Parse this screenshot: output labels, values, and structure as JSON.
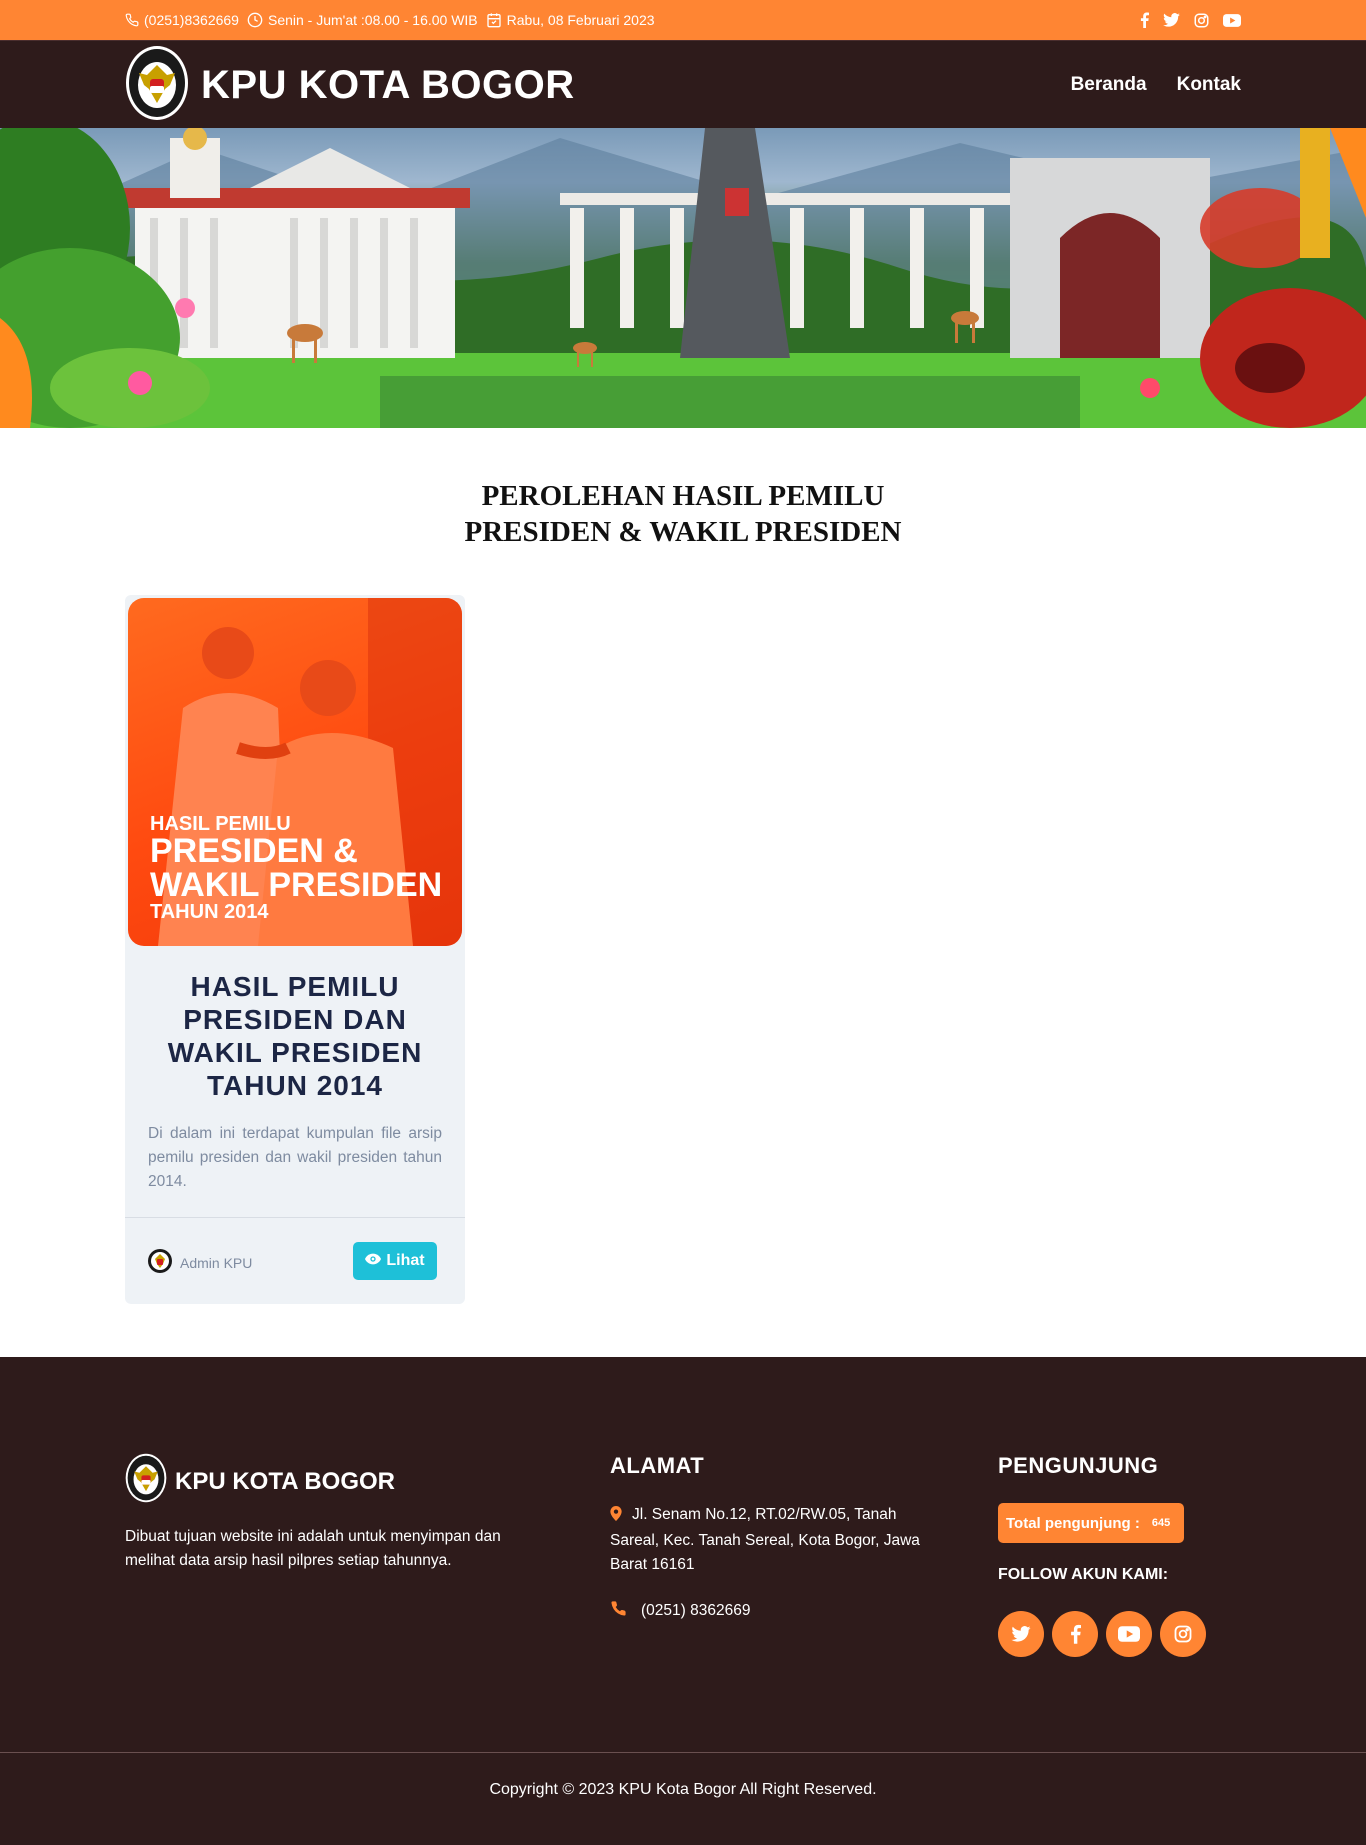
{
  "topbar": {
    "phone": "(0251)8362669",
    "hours": "Senin - Jum'at :08.00 - 16.00 WIB",
    "date": "Rabu, 08 Februari 2023",
    "social_icons": [
      "facebook-icon",
      "twitter-icon",
      "instagram-icon",
      "youtube-icon"
    ]
  },
  "header": {
    "logo_text_top": "KOMISI",
    "logo_text_bottom": "PEMILIHAN UMUM",
    "title": "KPU KOTA BOGOR",
    "nav": [
      "Beranda",
      "Kontak"
    ]
  },
  "main": {
    "title_line1": "PEROLEHAN HASIL PEMILU",
    "title_line2": "PRESIDEN & WAKIL PRESIDEN",
    "card": {
      "image_line1": "HASIL PEMILU",
      "image_line2": "PRESIDEN &",
      "image_line3": "WAKIL PRESIDEN",
      "image_line4": "TAHUN 2014",
      "title": "HASIL PEMILU PRESIDEN DAN WAKIL PRESIDEN TAHUN 2014",
      "description": "Di dalam ini terdapat kumpulan file arsip pemilu presiden dan wakil presiden tahun 2014.",
      "author": "Admin KPU",
      "button_label": "Lihat"
    }
  },
  "footer": {
    "brand": "KPU KOTA BOGOR",
    "about": "Dibuat tujuan website ini adalah untuk menyimpan dan melihat data arsip hasil pilpres setiap tahunnya.",
    "address_heading": "ALAMAT",
    "address": "Jl. Senam No.12, RT.02/RW.05, Tanah Sareal, Kec. Tanah Sereal, Kota Bogor, Jawa Barat 16161",
    "phone": "(0251) 8362669",
    "visitor_heading": "PENGUNJUNG",
    "visitor_label": "Total pengunjung :",
    "visitor_count": "645",
    "follow_heading": "FOLLOW AKUN KAMI:",
    "social_icons": [
      "twitter-icon",
      "facebook-icon",
      "youtube-icon",
      "instagram-icon"
    ],
    "copyright": "Copyright © 2023 KPU Kota Bogor All Right Reserved."
  },
  "colors": {
    "accent": "#ff8533",
    "dark": "#2e1b1b",
    "button": "#1ec0d8",
    "card_bg": "#eef2f6"
  }
}
